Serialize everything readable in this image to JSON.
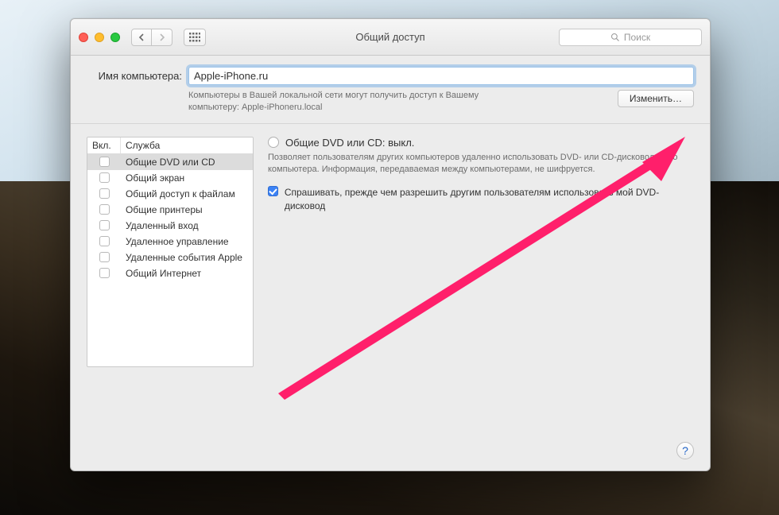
{
  "toolbar": {
    "title": "Общий доступ",
    "search_placeholder": "Поиск"
  },
  "header": {
    "name_label": "Имя компьютера:",
    "name_value": "Apple-iPhone.ru",
    "sub_text": "Компьютеры в Вашей локальной сети могут получить доступ к Вашему компьютеру: Apple-iPhoneru.local",
    "edit_label": "Изменить…"
  },
  "services": {
    "col_on": "Вкл.",
    "col_service": "Служба",
    "items": [
      {
        "label": "Общие DVD или CD",
        "on": false,
        "selected": true
      },
      {
        "label": "Общий экран",
        "on": false
      },
      {
        "label": "Общий доступ к файлам",
        "on": false
      },
      {
        "label": "Общие принтеры",
        "on": false
      },
      {
        "label": "Удаленный вход",
        "on": false
      },
      {
        "label": "Удаленное управление",
        "on": false
      },
      {
        "label": "Удаленные события Apple",
        "on": false
      },
      {
        "label": "Общий Интернет",
        "on": false
      }
    ]
  },
  "detail": {
    "status_title": "Общие DVD или CD: выкл.",
    "description": "Позволяет пользователям других компьютеров удаленно использовать DVD- или CD-дисковод этого компьютера. Информация, передаваемая между компьютерами, не шифруется.",
    "ask_checked": true,
    "ask_label": "Спрашивать, прежде чем разрешить другим пользователям использовать мой DVD-дисковод"
  },
  "help": "?"
}
